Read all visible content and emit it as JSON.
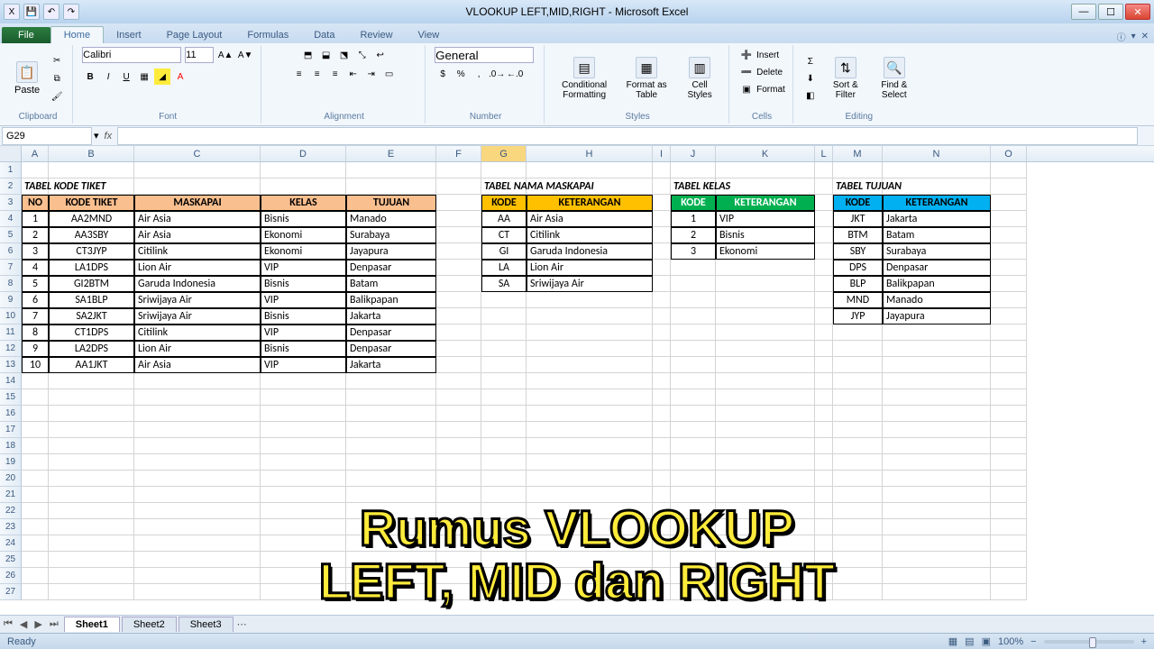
{
  "window": {
    "title": "VLOOKUP LEFT,MID,RIGHT - Microsoft Excel"
  },
  "tabs": {
    "file": "File",
    "home": "Home",
    "insert": "Insert",
    "pagelayout": "Page Layout",
    "formulas": "Formulas",
    "data": "Data",
    "review": "Review",
    "view": "View"
  },
  "ribbon": {
    "clipboard": "Clipboard",
    "paste": "Paste",
    "font": "Font",
    "font_name": "Calibri",
    "font_size": "11",
    "alignment": "Alignment",
    "number": "Number",
    "number_format": "General",
    "styles": "Styles",
    "cond": "Conditional Formatting",
    "fmt_table": "Format as Table",
    "cell_styles": "Cell Styles",
    "cells": "Cells",
    "insert": "Insert",
    "delete": "Delete",
    "format": "Format",
    "editing": "Editing",
    "sort": "Sort & Filter",
    "find": "Find & Select"
  },
  "namebox": "G29",
  "columns": [
    "A",
    "B",
    "C",
    "D",
    "E",
    "F",
    "G",
    "H",
    "I",
    "J",
    "K",
    "L",
    "M",
    "N",
    "O"
  ],
  "rows": [
    "1",
    "2",
    "3",
    "4",
    "5",
    "6",
    "7",
    "8",
    "9",
    "10",
    "11",
    "12",
    "13",
    "14",
    "15",
    "16",
    "17",
    "18",
    "19",
    "20",
    "21",
    "22",
    "23",
    "24",
    "25",
    "26",
    "27"
  ],
  "titles": {
    "tiket": "TABEL KODE TIKET",
    "maskapai": "TABEL NAMA MASKAPAI",
    "kelas": "TABEL KELAS",
    "tujuan": "TABEL TUJUAN"
  },
  "headers": {
    "no": "NO",
    "kode_tiket": "KODE TIKET",
    "maskapai": "MASKAPAI",
    "kelas": "KELAS",
    "tujuan": "TUJUAN",
    "kode": "KODE",
    "keterangan": "KETERANGAN"
  },
  "tiket": [
    {
      "no": "1",
      "kode": "AA2MND",
      "maskapai": "Air Asia",
      "kelas": "Bisnis",
      "tujuan": "Manado"
    },
    {
      "no": "2",
      "kode": "AA3SBY",
      "maskapai": "Air Asia",
      "kelas": "Ekonomi",
      "tujuan": "Surabaya"
    },
    {
      "no": "3",
      "kode": "CT3JYP",
      "maskapai": "Citilink",
      "kelas": "Ekonomi",
      "tujuan": "Jayapura"
    },
    {
      "no": "4",
      "kode": "LA1DPS",
      "maskapai": "Lion Air",
      "kelas": "VIP",
      "tujuan": "Denpasar"
    },
    {
      "no": "5",
      "kode": "GI2BTM",
      "maskapai": "Garuda Indonesia",
      "kelas": "Bisnis",
      "tujuan": "Batam"
    },
    {
      "no": "6",
      "kode": "SA1BLP",
      "maskapai": "Sriwijaya Air",
      "kelas": "VIP",
      "tujuan": "Balikpapan"
    },
    {
      "no": "7",
      "kode": "SA2JKT",
      "maskapai": "Sriwijaya Air",
      "kelas": "Bisnis",
      "tujuan": "Jakarta"
    },
    {
      "no": "8",
      "kode": "CT1DPS",
      "maskapai": "Citilink",
      "kelas": "VIP",
      "tujuan": "Denpasar"
    },
    {
      "no": "9",
      "kode": "LA2DPS",
      "maskapai": "Lion Air",
      "kelas": "Bisnis",
      "tujuan": "Denpasar"
    },
    {
      "no": "10",
      "kode": "AA1JKT",
      "maskapai": "Air Asia",
      "kelas": "VIP",
      "tujuan": "Jakarta"
    }
  ],
  "maskapai": [
    {
      "kode": "AA",
      "ket": "Air Asia"
    },
    {
      "kode": "CT",
      "ket": "Citilink"
    },
    {
      "kode": "GI",
      "ket": "Garuda Indonesia"
    },
    {
      "kode": "LA",
      "ket": "Lion Air"
    },
    {
      "kode": "SA",
      "ket": "Sriwijaya Air"
    }
  ],
  "kelas": [
    {
      "kode": "1",
      "ket": "VIP"
    },
    {
      "kode": "2",
      "ket": "Bisnis"
    },
    {
      "kode": "3",
      "ket": "Ekonomi"
    }
  ],
  "tujuan": [
    {
      "kode": "JKT",
      "ket": "Jakarta"
    },
    {
      "kode": "BTM",
      "ket": "Batam"
    },
    {
      "kode": "SBY",
      "ket": "Surabaya"
    },
    {
      "kode": "DPS",
      "ket": "Denpasar"
    },
    {
      "kode": "BLP",
      "ket": "Balikpapan"
    },
    {
      "kode": "MND",
      "ket": "Manado"
    },
    {
      "kode": "JYP",
      "ket": "Jayapura"
    }
  ],
  "overlay": {
    "line1": "Rumus VLOOKUP",
    "line2": "LEFT, MID dan RIGHT"
  },
  "sheets": {
    "s1": "Sheet1",
    "s2": "Sheet2",
    "s3": "Sheet3"
  },
  "status": {
    "ready": "Ready",
    "zoom": "100%"
  }
}
